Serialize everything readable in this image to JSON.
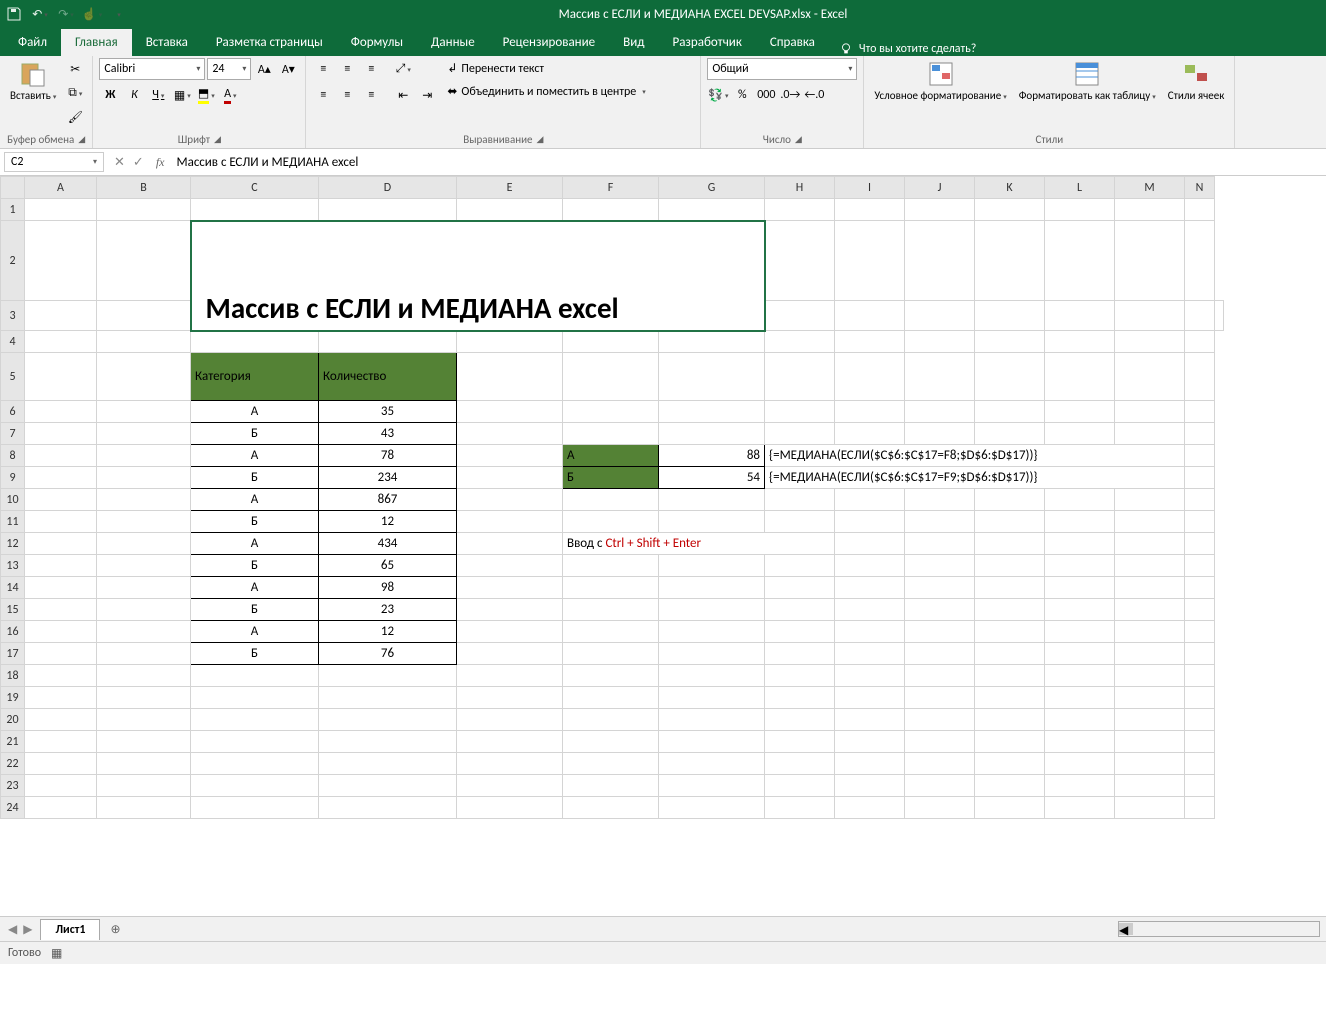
{
  "app": {
    "title": "Массив с ЕСЛИ и МЕДИАНА EXCEL DEVSAP.xlsx  -  Excel"
  },
  "tabs": {
    "file": "Файл",
    "home": "Главная",
    "insert": "Вставка",
    "layout": "Разметка страницы",
    "formulas": "Формулы",
    "data": "Данные",
    "review": "Рецензирование",
    "view": "Вид",
    "developer": "Разработчик",
    "help": "Справка",
    "tellme": "Что вы хотите сделать?"
  },
  "ribbon": {
    "clipboard": {
      "paste": "Вставить",
      "label": "Буфер обмена"
    },
    "font": {
      "name": "Calibri",
      "size": "24",
      "label": "Шрифт",
      "bold": "Ж",
      "italic": "К",
      "underline": "Ч"
    },
    "align": {
      "label": "Выравнивание",
      "wrap": "Перенести текст",
      "merge": "Объединить и поместить в центре"
    },
    "number": {
      "label": "Число",
      "format": "Общий"
    },
    "styles": {
      "label": "Стили",
      "cond": "Условное форматирование",
      "table": "Форматировать как таблицу",
      "cell": "Стили ячеек"
    }
  },
  "namebox": "C2",
  "formula": "Массив с ЕСЛИ и МЕДИАНА excel",
  "columns": [
    "A",
    "B",
    "C",
    "D",
    "E",
    "F",
    "G",
    "H",
    "I",
    "J",
    "K",
    "L",
    "M",
    "N"
  ],
  "sheet": {
    "title": "Массив с ЕСЛИ и МЕДИАНА excel",
    "headers": {
      "c": "Категория",
      "d": "Количество"
    },
    "data": [
      {
        "c": "А",
        "d": "35"
      },
      {
        "c": "Б",
        "d": "43"
      },
      {
        "c": "А",
        "d": "78"
      },
      {
        "c": "Б",
        "d": "234"
      },
      {
        "c": "А",
        "d": "867"
      },
      {
        "c": "Б",
        "d": "12"
      },
      {
        "c": "А",
        "d": "434"
      },
      {
        "c": "Б",
        "d": "65"
      },
      {
        "c": "А",
        "d": "98"
      },
      {
        "c": "Б",
        "d": "23"
      },
      {
        "c": "А",
        "d": "12"
      },
      {
        "c": "Б",
        "d": "76"
      }
    ],
    "results": [
      {
        "key": "А",
        "val": "88",
        "f": "{=МЕДИАНА(ЕСЛИ($C$6:$C$17=F8;$D$6:$D$17))}"
      },
      {
        "key": "Б",
        "val": "54",
        "f": "{=МЕДИАНА(ЕСЛИ($C$6:$C$17=F9;$D$6:$D$17))}"
      }
    ],
    "hint_prefix": "Ввод с ",
    "hint_red": "Ctrl + Shift + Enter"
  },
  "bottom": {
    "sheet1": "Лист1"
  },
  "status": {
    "ready": "Готово"
  }
}
